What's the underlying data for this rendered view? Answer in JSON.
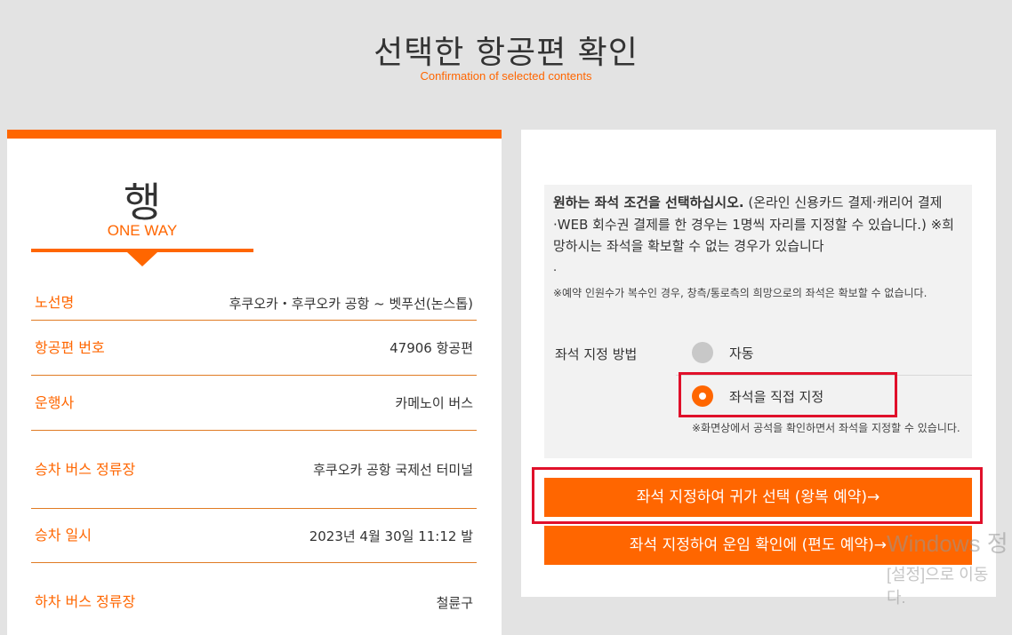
{
  "header": {
    "title": "선택한 항공편 확인",
    "subtitle": "Confirmation of selected contents"
  },
  "trip": {
    "direction": "행",
    "direction_en": "ONE WAY"
  },
  "info_rows": [
    {
      "label": "노선명",
      "value": "후쿠오카・후쿠오카 공항 ~ 벳푸선(논스톱)"
    },
    {
      "label": "항공편 번호",
      "value": "47906 항공편"
    },
    {
      "label": "운행사",
      "value": "카메노이 버스"
    },
    {
      "label": "승차 버스 정류장",
      "value": "후쿠오카 공항 국제선 터미널"
    },
    {
      "label": "승차 일시",
      "value": "2023년 4월 30일 11:12 발"
    },
    {
      "label": "하차 버스 정류장",
      "value": "철륜구"
    }
  ],
  "seat": {
    "notice_bold": "원하는 좌석 조건을 선택하십시오.",
    "notice_text": " (온라인 신용카드 결제·캐리어 결제·WEB 회수권 결제를 한 경우는 1명씩 자리를 지정할 수 있습니다.) ※희망하시는 좌석을 확보할 수 없는 경우가 있습니다",
    "dot": ".",
    "note": "※예약 인원수가 복수인 경우, 창측/통로측의 희망으로의 좌석은 확보할 수 없습니다.",
    "method_label": "좌석 지정 방법",
    "option_auto": "자동",
    "option_manual": "좌석을 직접 지정",
    "manual_hint": "※화면상에서 공석을 확인하면서 좌석을 지정할 수 있습니다."
  },
  "buttons": {
    "round_trip": "좌석 지정하여 귀가 선택 (왕복 예약)→",
    "one_way": "좌석 지정하여 운임 확인에 (편도 예약)→"
  },
  "watermark": {
    "line1": "Windows 정",
    "line2": "[설정]으로 이동",
    "line3": "다."
  },
  "colors": {
    "accent": "#ff6600",
    "highlight": "#e0102a",
    "background": "#e3e3e3"
  }
}
